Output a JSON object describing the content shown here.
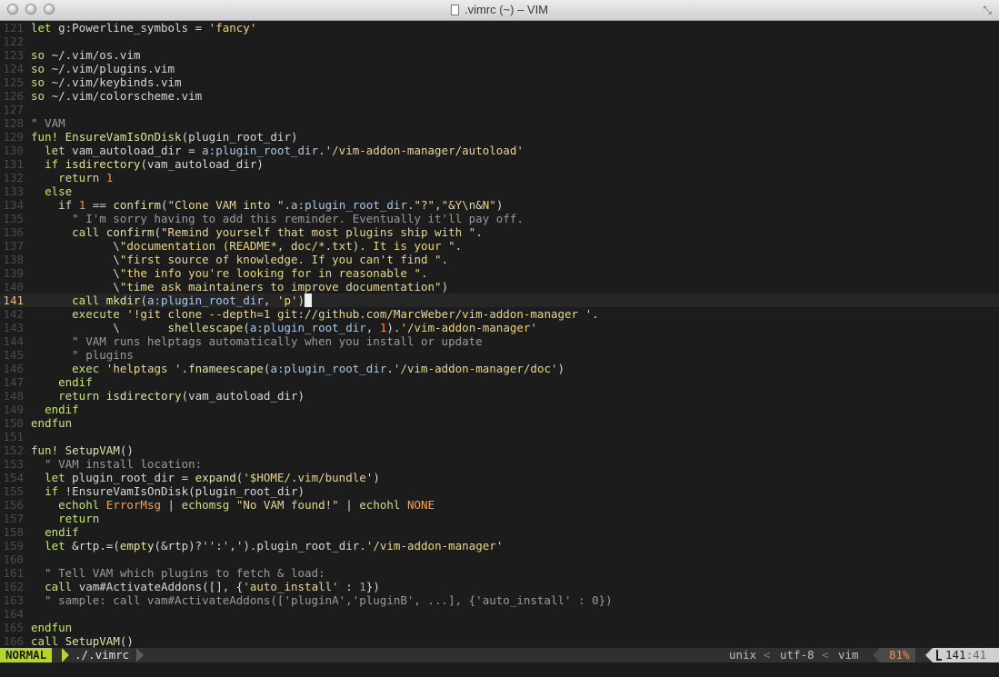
{
  "window": {
    "title": ".vimrc (~) – VIM"
  },
  "editor": {
    "lines": [
      {
        "num": "121",
        "code": "let g:Powerline_symbols = 'fancy'"
      },
      {
        "num": "122",
        "code": ""
      },
      {
        "num": "123",
        "code": "so ~/.vim/os.vim"
      },
      {
        "num": "124",
        "code": "so ~/.vim/plugins.vim"
      },
      {
        "num": "125",
        "code": "so ~/.vim/keybinds.vim"
      },
      {
        "num": "126",
        "code": "so ~/.vim/colorscheme.vim"
      },
      {
        "num": "127",
        "code": ""
      },
      {
        "num": "128",
        "code": "\" VAM"
      },
      {
        "num": "129",
        "code": "fun! EnsureVamIsOnDisk(plugin_root_dir)"
      },
      {
        "num": "130",
        "code": "  let vam_autoload_dir = a:plugin_root_dir.'/vim-addon-manager/autoload'"
      },
      {
        "num": "131",
        "code": "  if isdirectory(vam_autoload_dir)"
      },
      {
        "num": "132",
        "code": "    return 1"
      },
      {
        "num": "133",
        "code": "  else"
      },
      {
        "num": "134",
        "code": "    if 1 == confirm(\"Clone VAM into \".a:plugin_root_dir.\"?\",\"&Y\\n&N\")"
      },
      {
        "num": "135",
        "code": "      \" I'm sorry having to add this reminder. Eventually it'll pay off."
      },
      {
        "num": "136",
        "code": "      call confirm(\"Remind yourself that most plugins ship with \"."
      },
      {
        "num": "137",
        "code": "            \\\"documentation (README*, doc/*.txt). It is your \"."
      },
      {
        "num": "138",
        "code": "            \\\"first source of knowledge. If you can't find \"."
      },
      {
        "num": "139",
        "code": "            \\\"the info you're looking for in reasonable \"."
      },
      {
        "num": "140",
        "code": "            \\\"time ask maintainers to improve documentation\")"
      },
      {
        "num": "141",
        "code": "      call mkdir(a:plugin_root_dir, 'p')"
      },
      {
        "num": "142",
        "code": "      execute '!git clone --depth=1 git://github.com/MarcWeber/vim-addon-manager '."
      },
      {
        "num": "143",
        "code": "            \\       shellescape(a:plugin_root_dir, 1).'/vim-addon-manager'"
      },
      {
        "num": "144",
        "code": "      \" VAM runs helptags automatically when you install or update"
      },
      {
        "num": "145",
        "code": "      \" plugins"
      },
      {
        "num": "146",
        "code": "      exec 'helptags '.fnameescape(a:plugin_root_dir.'/vim-addon-manager/doc')"
      },
      {
        "num": "147",
        "code": "    endif"
      },
      {
        "num": "148",
        "code": "    return isdirectory(vam_autoload_dir)"
      },
      {
        "num": "149",
        "code": "  endif"
      },
      {
        "num": "150",
        "code": "endfun"
      },
      {
        "num": "151",
        "code": ""
      },
      {
        "num": "152",
        "code": "fun! SetupVAM()"
      },
      {
        "num": "153",
        "code": "  \" VAM install location:"
      },
      {
        "num": "154",
        "code": "  let plugin_root_dir = expand('$HOME/.vim/bundle')"
      },
      {
        "num": "155",
        "code": "  if !EnsureVamIsOnDisk(plugin_root_dir)"
      },
      {
        "num": "156",
        "code": "    echohl ErrorMsg | echomsg \"No VAM found!\" | echohl NONE"
      },
      {
        "num": "157",
        "code": "    return"
      },
      {
        "num": "158",
        "code": "  endif"
      },
      {
        "num": "159",
        "code": "  let &rtp.=(empty(&rtp)?'':',').plugin_root_dir.'/vim-addon-manager'"
      },
      {
        "num": "160",
        "code": ""
      },
      {
        "num": "161",
        "code": "  \" Tell VAM which plugins to fetch & load:"
      },
      {
        "num": "162",
        "code": "  call vam#ActivateAddons([], {'auto_install' : 1})"
      },
      {
        "num": "163",
        "code": "  \" sample: call vam#ActivateAddons(['pluginA','pluginB', ...], {'auto_install' : 0})"
      },
      {
        "num": "164",
        "code": ""
      },
      {
        "num": "165",
        "code": "endfun"
      },
      {
        "num": "166",
        "code": "call SetupVAM()"
      }
    ],
    "current_line": "141"
  },
  "statusbar": {
    "mode": "NORMAL",
    "file": "./.vimrc",
    "fileformat": "unix",
    "encoding": "utf-8",
    "filetype": "vim",
    "percent": "81%",
    "line": "141",
    "column": "41"
  },
  "colors": {
    "background": "#1c1c1c",
    "mode_bg": "#b5d629",
    "keyword": "#c5e478",
    "string": "#e8d68b",
    "number": "#ff8a47",
    "comment": "#9a9a9a"
  }
}
